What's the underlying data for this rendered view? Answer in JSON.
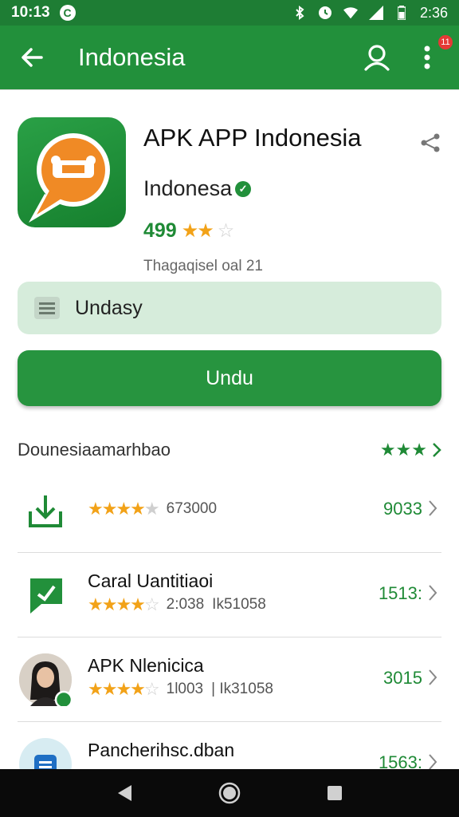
{
  "status_bar": {
    "time": "10:13",
    "badge": "C",
    "clock": "2:36"
  },
  "app_bar": {
    "title": "Indonesia",
    "notification_count": "11"
  },
  "app": {
    "name": "APK APP Indonesia",
    "developer": "Indonesa",
    "rating": "499",
    "stars": "★★",
    "stars_empty": "☆",
    "subtitle": "Thagaqisel oal 21"
  },
  "buttons": {
    "secondary": "Undasy",
    "primary": "Undu"
  },
  "section": {
    "title": "Dounesiaamarhbao",
    "stars": "★★★"
  },
  "list": [
    {
      "name": "",
      "stars": "★★★★",
      "stars_empty": "★",
      "meta1": "673000",
      "meta2": "",
      "count": "9033"
    },
    {
      "name": "Caral Uantitiaoi",
      "stars": "★★★★",
      "stars_empty": "☆",
      "meta1": "2:038",
      "meta2": "Ik51058",
      "count": "1513:"
    },
    {
      "name": "APK Nlenicica",
      "stars": "★★★★",
      "stars_empty": "☆",
      "meta1": "1l003",
      "meta2": "| Ik31058",
      "count": "3015"
    },
    {
      "name": "Pancherihsc.dban",
      "stars": "",
      "stars_empty": "",
      "meta1": "",
      "meta2": "",
      "count": "1563:"
    }
  ],
  "colors": {
    "primary": "#22903b",
    "status_bar": "#1e7d34",
    "accent_star": "#f2a218",
    "light_green": "#d6ecdb"
  },
  "icons": {
    "back": "arrow-left-icon",
    "account": "person-icon",
    "menu": "more-vert-icon",
    "share": "share-icon",
    "secondary": "list-icon",
    "nav_back": "triangle-back-icon",
    "nav_home": "circle-home-icon",
    "nav_recent": "square-recent-icon"
  }
}
